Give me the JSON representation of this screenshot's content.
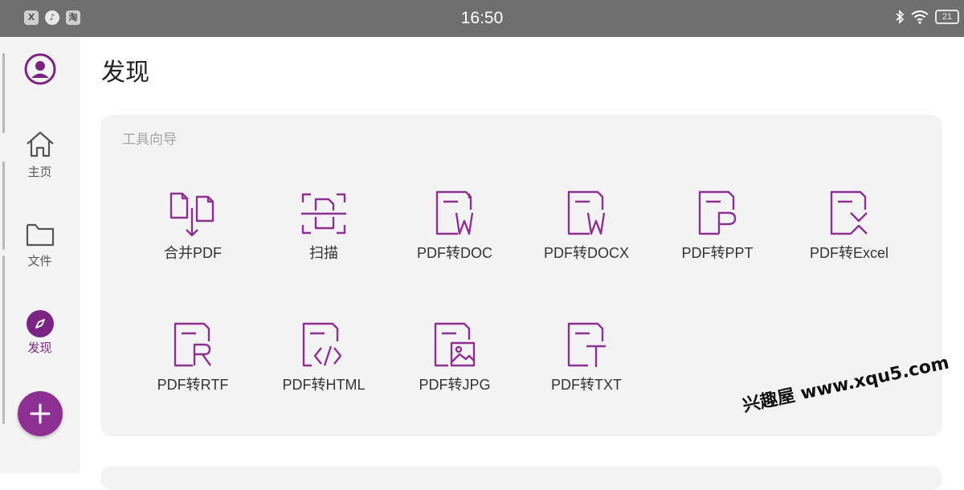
{
  "status_bar": {
    "time": "16:50",
    "battery": "21",
    "notification_apps": [
      "x-app-icon",
      "music-app-icon",
      "taobao-app-icon"
    ],
    "notification_glyphs": [
      "X",
      "♪",
      "淘"
    ]
  },
  "sidebar": {
    "items": [
      {
        "label": "主页",
        "icon": "home-icon"
      },
      {
        "label": "文件",
        "icon": "folder-icon"
      },
      {
        "label": "发现",
        "icon": "compass-icon",
        "active": true
      }
    ],
    "accent_color": "#7b2583"
  },
  "page": {
    "title": "发现"
  },
  "tools_section": {
    "title": "工具向导",
    "tools": [
      {
        "label": "合并PDF",
        "icon": "merge-pdf-icon"
      },
      {
        "label": "扫描",
        "icon": "scan-icon"
      },
      {
        "label": "PDF转DOC",
        "icon": "pdf-to-doc-icon"
      },
      {
        "label": "PDF转DOCX",
        "icon": "pdf-to-docx-icon"
      },
      {
        "label": "PDF转PPT",
        "icon": "pdf-to-ppt-icon"
      },
      {
        "label": "PDF转Excel",
        "icon": "pdf-to-excel-icon"
      },
      {
        "label": "PDF转RTF",
        "icon": "pdf-to-rtf-icon"
      },
      {
        "label": "PDF转HTML",
        "icon": "pdf-to-html-icon"
      },
      {
        "label": "PDF转JPG",
        "icon": "pdf-to-jpg-icon"
      },
      {
        "label": "PDF转TXT",
        "icon": "pdf-to-txt-icon"
      }
    ]
  },
  "watermark": "兴趣屋 www.xqu5.com"
}
